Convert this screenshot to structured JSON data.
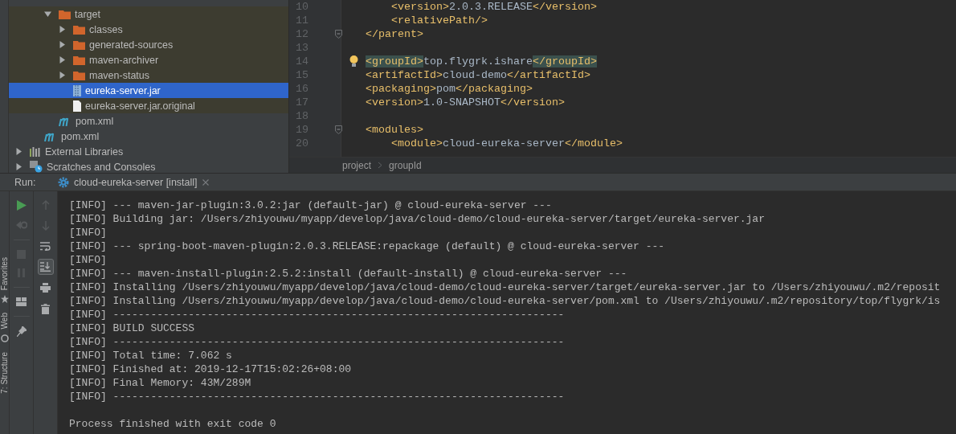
{
  "project_tree": [
    {
      "children": [
        {
          "children": [
            {
              "label": "target",
              "kind": "folder",
              "expanded": true,
              "excluded": true,
              "selected": false,
              "children": [
                {
                  "label": "classes",
                  "kind": "folder",
                  "expanded": false,
                  "excluded": true,
                  "selected": false
                },
                {
                  "label": "generated-sources",
                  "kind": "folder",
                  "expanded": false,
                  "excluded": true,
                  "selected": false
                },
                {
                  "label": "maven-archiver",
                  "kind": "folder",
                  "expanded": false,
                  "excluded": true,
                  "selected": false
                },
                {
                  "label": "maven-status",
                  "kind": "folder",
                  "expanded": false,
                  "excluded": true,
                  "selected": false
                },
                {
                  "label": "eureka-server.jar",
                  "kind": "jar",
                  "excluded": true,
                  "selected": true
                },
                {
                  "label": "eureka-server.jar.original",
                  "kind": "file",
                  "excluded": true,
                  "selected": false
                }
              ]
            },
            {
              "label": "pom.xml",
              "kind": "maven",
              "excluded": false,
              "selected": false
            }
          ]
        },
        {
          "label": "pom.xml",
          "kind": "maven",
          "excluded": false,
          "selected": false
        }
      ]
    },
    {
      "label": "External Libraries",
      "kind": "libraries",
      "expanded": false,
      "excluded": false,
      "selected": false
    },
    {
      "label": "Scratches and Consoles",
      "kind": "scratches",
      "expanded": false,
      "excluded": false,
      "selected": false
    }
  ],
  "editor": {
    "lines": [
      {
        "number": "10",
        "tokens": [
          {
            "kind": "tag",
            "text": "    <version>"
          },
          {
            "kind": "text",
            "text": "2.0.3.RELEASE"
          },
          {
            "kind": "tag",
            "text": "</version>"
          }
        ]
      },
      {
        "number": "11",
        "tokens": [
          {
            "kind": "tag",
            "text": "    <relativePath/>"
          }
        ]
      },
      {
        "number": "12",
        "fold": true,
        "tokens": [
          {
            "kind": "tag",
            "text": "</parent>"
          }
        ]
      },
      {
        "number": "13"
      },
      {
        "number": "14",
        "hint": true,
        "tokens": [
          {
            "kind": "tag_match",
            "text": "<groupId>"
          },
          {
            "kind": "text",
            "text": "top.flygrk.ishare"
          },
          {
            "kind": "tag_match",
            "text": "</groupId>"
          }
        ]
      },
      {
        "number": "15",
        "tokens": [
          {
            "kind": "tag",
            "text": "<artifactId>"
          },
          {
            "kind": "text",
            "text": "cloud-demo"
          },
          {
            "kind": "tag",
            "text": "</artifactId>"
          }
        ]
      },
      {
        "number": "16",
        "tokens": [
          {
            "kind": "tag",
            "text": "<packaging>"
          },
          {
            "kind": "text",
            "text": "pom"
          },
          {
            "kind": "tag",
            "text": "</packaging>"
          }
        ]
      },
      {
        "number": "17",
        "tokens": [
          {
            "kind": "tag",
            "text": "<version>"
          },
          {
            "kind": "text",
            "text": "1.0-SNAPSHOT"
          },
          {
            "kind": "tag",
            "text": "</version>"
          }
        ]
      },
      {
        "number": "18"
      },
      {
        "number": "19",
        "fold": true,
        "tokens": [
          {
            "kind": "tag",
            "text": "<modules>"
          }
        ]
      },
      {
        "number": "20",
        "tokens": [
          {
            "kind": "tag",
            "text": "    <module>"
          },
          {
            "kind": "text",
            "text": "cloud-eureka-server"
          },
          {
            "kind": "tag",
            "text": "</module>"
          }
        ]
      }
    ],
    "breadcrumbs": [
      "project",
      "groupId"
    ]
  },
  "run": {
    "label": "Run:",
    "tabs": [
      {
        "label": "cloud-eureka-server [install]"
      }
    ],
    "scroll_to_end_on": true,
    "console": [
      "[INFO] --- maven-jar-plugin:3.0.2:jar (default-jar) @ cloud-eureka-server ---",
      "[INFO] Building jar: /Users/zhiyouwu/myapp/develop/java/cloud-demo/cloud-eureka-server/target/eureka-server.jar",
      "[INFO]",
      "[INFO] --- spring-boot-maven-plugin:2.0.3.RELEASE:repackage (default) @ cloud-eureka-server ---",
      "[INFO]",
      "[INFO] --- maven-install-plugin:2.5.2:install (default-install) @ cloud-eureka-server ---",
      "[INFO] Installing /Users/zhiyouwu/myapp/develop/java/cloud-demo/cloud-eureka-server/target/eureka-server.jar to /Users/zhiyouwu/.m2/reposit",
      "[INFO] Installing /Users/zhiyouwu/myapp/develop/java/cloud-demo/cloud-eureka-server/pom.xml to /Users/zhiyouwu/.m2/repository/top/flygrk/is",
      "[INFO] ------------------------------------------------------------------------",
      "[INFO] BUILD SUCCESS",
      "[INFO] ------------------------------------------------------------------------",
      "[INFO] Total time: 7.062 s",
      "[INFO] Finished at: 2019-12-17T15:02:26+08:00",
      "[INFO] Final Memory: 43M/289M",
      "[INFO] ------------------------------------------------------------------------"
    ],
    "exit_message": "Process finished with exit code 0"
  },
  "side_stripe": [
    "Favorites",
    "Web",
    "7: Structure"
  ]
}
